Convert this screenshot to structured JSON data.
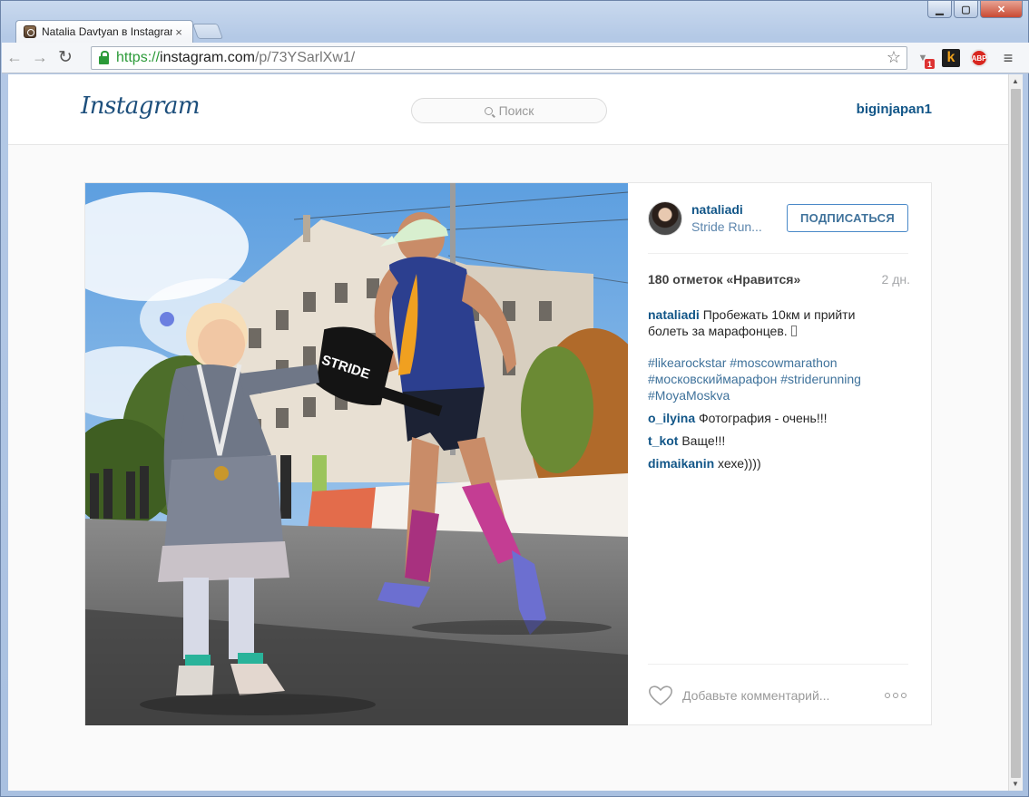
{
  "browser": {
    "tab_title": "Natalia Davtyan в Instagram",
    "tab_close": "×",
    "url": {
      "scheme": "https://",
      "host": "instagram.com",
      "path": "/p/73YSarlXw1/"
    },
    "shield_badge": "1",
    "kippt_label": "k",
    "abp_label": "ABP",
    "icons": [
      "back-arrow-icon",
      "forward-arrow-icon",
      "reload-icon",
      "lock-icon",
      "star-icon",
      "menu-icon"
    ]
  },
  "header": {
    "logo": "Instagram",
    "search_placeholder": "Поиск",
    "current_user": "biginjapan1"
  },
  "post": {
    "author": "nataliadi",
    "location": "Stride Run...",
    "follow_label": "ПОДПИСАТЬСЯ",
    "likes": "180 отметок «Нравится»",
    "time": "2 дн.",
    "caption": {
      "user": "nataliadi",
      "text": "Пробежать 10км и прийти болеть за марафонцев."
    },
    "hashtags": [
      "#likearockstar",
      "#moscowmarathon",
      "#московскиймарафон",
      "#striderunning",
      "#MoyaMoskva"
    ],
    "comments": [
      {
        "user": "o_ilyina",
        "text": "Фотография - очень!!!"
      },
      {
        "user": "t_kot",
        "text": "Ваще!!!"
      },
      {
        "user": "dimaikanin",
        "text": "хехе))))"
      }
    ],
    "add_comment_placeholder": "Добавьте комментарий...",
    "photo_sign_text": "STRIDE",
    "colors": {
      "link": "#125688",
      "tag": "#3f729b",
      "follow_border": "#4a89c8"
    }
  }
}
